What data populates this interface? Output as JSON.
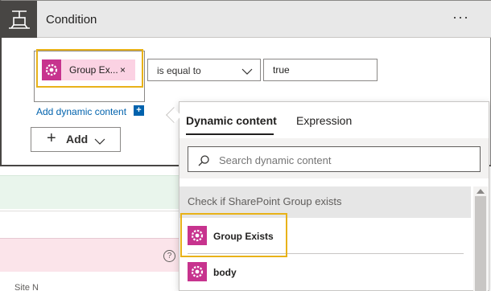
{
  "condition": {
    "title": "Condition",
    "more_label": "···",
    "token": {
      "label": "Group Ex...",
      "remove": "×"
    },
    "operator": "is equal to",
    "value": "true",
    "add_dynamic_label": "Add dynamic content",
    "add_dynamic_icon": "+",
    "add_button": {
      "icon": "+",
      "label": "Add"
    }
  },
  "flyout": {
    "tabs": [
      {
        "label": "Dynamic content",
        "active": true
      },
      {
        "label": "Expression",
        "active": false
      }
    ],
    "search_placeholder": "Search dynamic content",
    "section_label": "Check if SharePoint Group exists",
    "items": [
      {
        "label": "Group Exists",
        "icon": "sharepoint-gear-icon"
      },
      {
        "label": "body",
        "icon": "sharepoint-gear-icon"
      }
    ]
  },
  "background": {
    "help_icon": "?",
    "partial_text": "Site N"
  },
  "colors": {
    "accent_pink": "#c7338e",
    "token_bg": "#fbd2e3",
    "highlight": "#e8b219",
    "link_blue": "#0062ad",
    "header_dark": "#484644"
  }
}
